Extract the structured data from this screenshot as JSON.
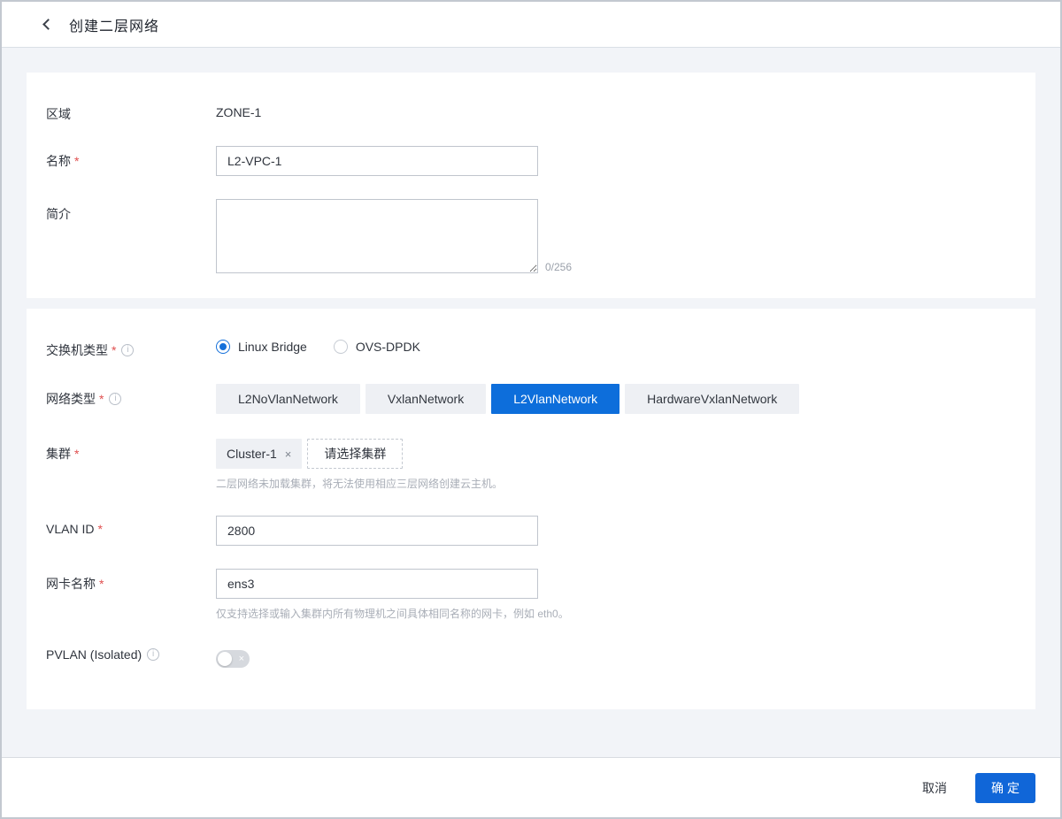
{
  "header": {
    "title": "创建二层网络"
  },
  "icons": {
    "info": "i",
    "close": "×",
    "toggle_off": "×"
  },
  "basic": {
    "zone": {
      "label": "区域",
      "value": "ZONE-1"
    },
    "name": {
      "label": "名称",
      "required": "*",
      "value": "L2-VPC-1"
    },
    "description": {
      "label": "简介",
      "value": "",
      "counter": "0/256"
    }
  },
  "config": {
    "switch_type": {
      "label": "交换机类型",
      "required": "*",
      "options": [
        "Linux Bridge",
        "OVS-DPDK"
      ],
      "selected": "Linux Bridge"
    },
    "network_type": {
      "label": "网络类型",
      "required": "*",
      "options": [
        "L2NoVlanNetwork",
        "VxlanNetwork",
        "L2VlanNetwork",
        "HardwareVxlanNetwork"
      ],
      "selected": "L2VlanNetwork"
    },
    "cluster": {
      "label": "集群",
      "required": "*",
      "selected_tag": "Cluster-1",
      "placeholder_button": "请选择集群",
      "hint": "二层网络未加载集群，将无法使用相应三层网络创建云主机。"
    },
    "vlan_id": {
      "label": "VLAN ID",
      "required": "*",
      "value": "2800"
    },
    "nic_name": {
      "label": "网卡名称",
      "required": "*",
      "value": "ens3",
      "hint": "仅支持选择或输入集群内所有物理机之间具体相同名称的网卡，例如 eth0。"
    },
    "pvlan": {
      "label": "PVLAN (Isolated)",
      "state": "off"
    }
  },
  "footer": {
    "cancel": "取消",
    "confirm": "确定"
  },
  "colors": {
    "accent_blue": "#1066d8",
    "selected_segment_blue": "#0d6edb",
    "required_red": "#e04f4f",
    "page_background": "#f2f4f8",
    "card_background": "#ffffff",
    "hint_gray": "#a9aeb7"
  }
}
